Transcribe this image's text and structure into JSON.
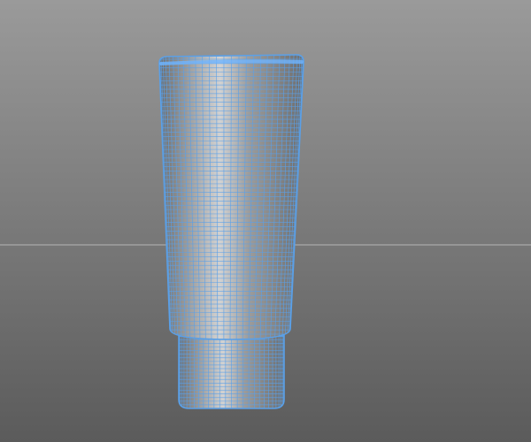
{
  "viewport": {
    "view_mode": "perspective",
    "display_mode": "wireframe-on-shaded",
    "background_gradient": {
      "top": "#9a9a9a",
      "bottom": "#5b5b5b"
    },
    "horizon_color": "#b4b4b4",
    "grid_visible": false
  },
  "object": {
    "type": "mesh",
    "shape": "squeeze-tube",
    "selected": true,
    "wire_color": "#5aa0e8",
    "edge_highlight_color": "#6eb4ff",
    "shade_light": "#d2d2d2",
    "shade_mid": "#9c9c9c",
    "shade_dark": "#6e6e6e"
  }
}
